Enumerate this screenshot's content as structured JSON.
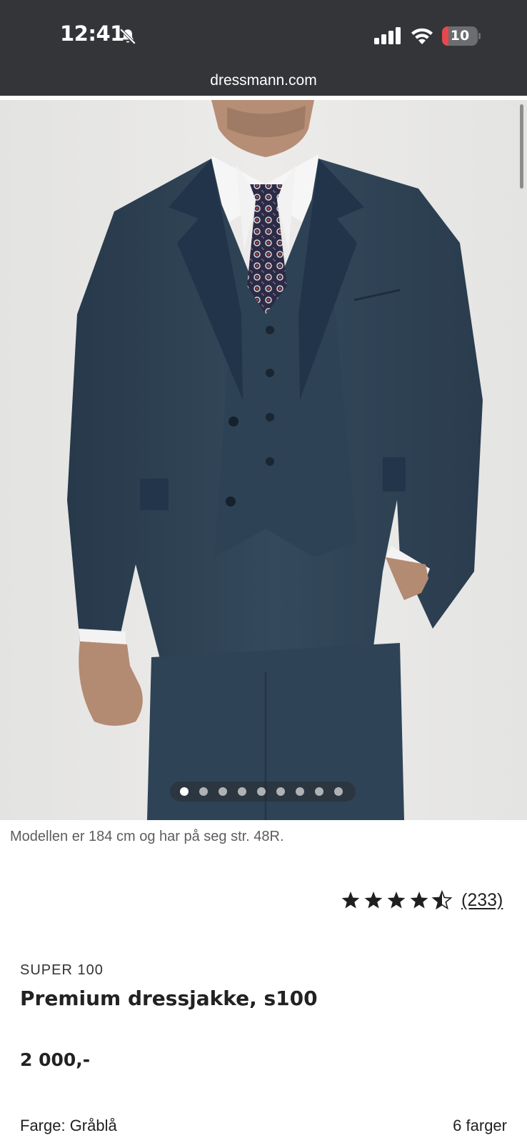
{
  "status_bar": {
    "time": "12:41",
    "battery_level": "10",
    "battery_fraction": 0.1,
    "colors": {
      "background": "#333538",
      "battery_low": "#e5484d"
    },
    "icons": [
      "bell-muted-icon",
      "cellular-signal-icon",
      "wifi-icon",
      "battery-icon"
    ]
  },
  "browser": {
    "url": "dressmann.com"
  },
  "gallery": {
    "image": "product-photo",
    "image_count": 9,
    "current_index": 0
  },
  "product": {
    "model_note": "Modellen er 184 cm og har på seg str. 48R.",
    "rating": {
      "stars": 4.5,
      "max": 5,
      "count_label": "(233)"
    },
    "brand": "SUPER 100",
    "name": "Premium dressjakke, s100",
    "price": "2 000,-",
    "color_label": "Farge: Gråblå",
    "color_count": "6 farger"
  }
}
